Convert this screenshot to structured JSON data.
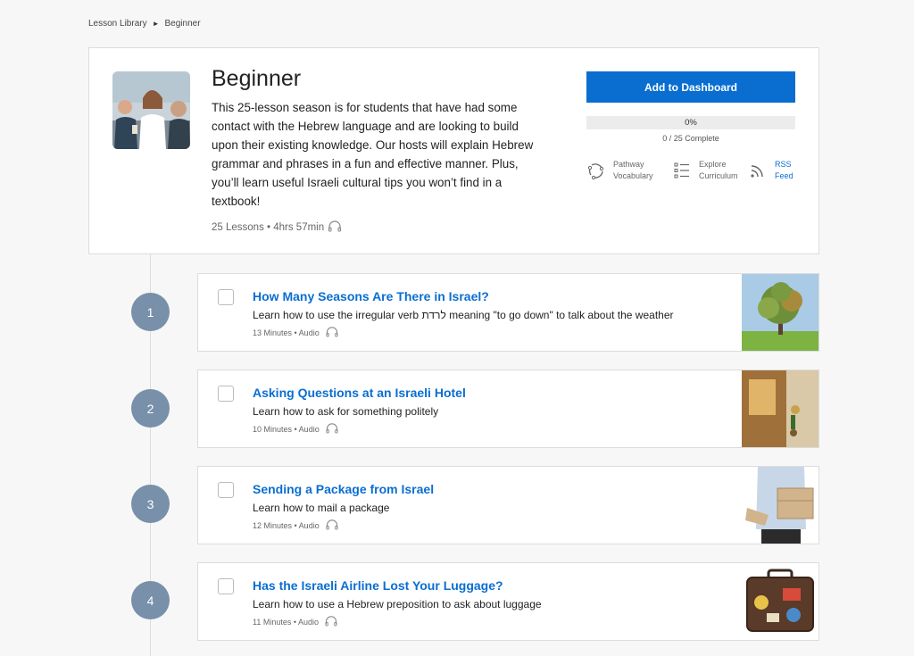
{
  "breadcrumb": {
    "root": "Lesson Library",
    "separator": "►",
    "current": "Beginner"
  },
  "season": {
    "title": "Beginner",
    "description": "This 25-lesson season is for students that have had some contact with the Hebrew language and are looking to build upon their existing knowledge. Our hosts will explain Hebrew grammar and phrases in a fun and effective manner. Plus, you’ll learn useful Israeli cultural tips you won’t find in a textbook!",
    "meta": "25 Lessons • 4hrs 57min",
    "add_button": "Add to Dashboard",
    "progress_percent_label": "0%",
    "progress_fraction": 0,
    "progress_text": "0 / 25 Complete",
    "actions": {
      "pathway_line1": "Pathway",
      "pathway_line2": "Vocabulary",
      "explore_line1": "Explore",
      "explore_line2": "Curriculum",
      "rss_line1": "RSS",
      "rss_line2": "Feed"
    }
  },
  "lessons": [
    {
      "number": "1",
      "title": "How Many Seasons Are There in Israel?",
      "description": "Learn how to use the irregular verb לרדת meaning \"to go down\" to talk about the weather",
      "meta": "13 Minutes • Audio",
      "thumb": "tree-image"
    },
    {
      "number": "2",
      "title": "Asking Questions at an Israeli Hotel",
      "description": "Learn how to ask for something politely",
      "meta": "10 Minutes • Audio",
      "thumb": "hotel-key-image"
    },
    {
      "number": "3",
      "title": "Sending a Package from Israel",
      "description": "Learn how to mail a package",
      "meta": "12 Minutes • Audio",
      "thumb": "package-image"
    },
    {
      "number": "4",
      "title": "Has the Israeli Airline Lost Your Luggage?",
      "description": "Learn how to use a Hebrew preposition to ask about luggage",
      "meta": "11 Minutes • Audio",
      "thumb": "suitcase-image"
    }
  ],
  "colors": {
    "accent": "#0a6ed1",
    "lesson_number_bg": "#7890aa",
    "background": "#f7f7f7"
  }
}
